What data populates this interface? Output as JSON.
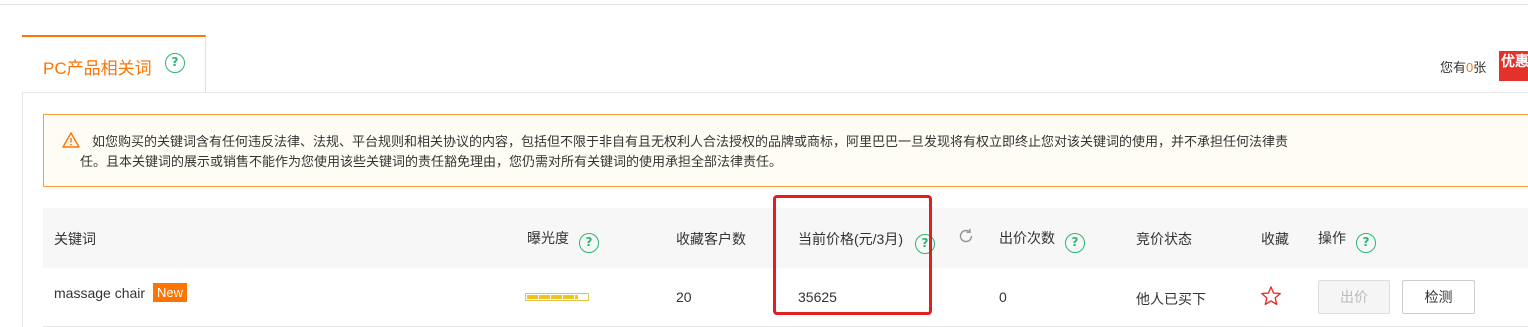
{
  "tab": {
    "label": "PC产品相关词",
    "help": "?"
  },
  "coupon": {
    "prefix": "您有",
    "count": "0",
    "suffix": "张",
    "badge": "优惠"
  },
  "notice": {
    "line1": "如您购买的关键词含有任何违反法律、法规、平台规则和相关协议的内容，包括但不限于非自有且无权利人合法授权的品牌或商标，阿里巴巴一旦发现将有权立即终止您对该关键词的使用，并不承担任何法律责",
    "line2": "任。且本关键词的展示或销售不能作为您使用该些关键词的责任豁免理由，您仍需对所有关键词的使用承担全部法律责任。"
  },
  "columns": {
    "keyword": "关键词",
    "exposure": "曝光度",
    "favorites": "收藏客户数",
    "price": "当前价格(元/3月)",
    "bids": "出价次数",
    "status": "竞价状态",
    "collect": "收藏",
    "action": "操作",
    "help": "?"
  },
  "rows": [
    {
      "keyword": "massage chair",
      "badge": "New",
      "exposure_level": 0.85,
      "favorites": "20",
      "price": "35625",
      "bids": "0",
      "status": "他人已买下",
      "bid_button": "出价",
      "check_button": "检测"
    }
  ],
  "colors": {
    "accent": "#ff7300",
    "help": "#2bb673",
    "highlight": "#e02020"
  }
}
